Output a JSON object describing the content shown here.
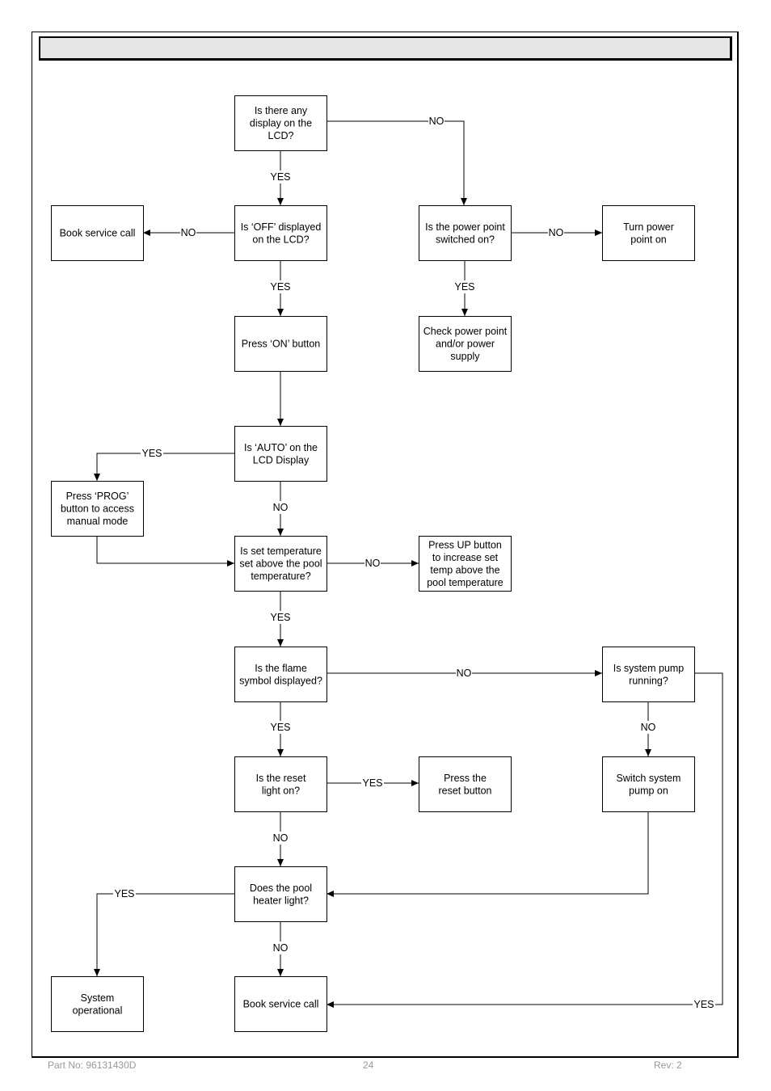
{
  "title_bar": {
    "text": ""
  },
  "nodes": [
    {
      "id": "n_display",
      "lines": [
        "Is there any",
        "display on the",
        "LCD?"
      ]
    },
    {
      "id": "n_off",
      "lines": [
        "Is ‘OFF’ displayed",
        "on the LCD?"
      ]
    },
    {
      "id": "n_book1",
      "lines": [
        "Book service call"
      ]
    },
    {
      "id": "n_power",
      "lines": [
        "Is the power point",
        "switched on?"
      ]
    },
    {
      "id": "n_turnon",
      "lines": [
        "Turn power",
        "point on"
      ]
    },
    {
      "id": "n_check",
      "lines": [
        "Check power point",
        "and/or power",
        "supply"
      ]
    },
    {
      "id": "n_presson",
      "lines": [
        "Press ‘ON’ button"
      ]
    },
    {
      "id": "n_auto",
      "lines": [
        "Is ‘AUTO’ on the",
        "LCD Display"
      ]
    },
    {
      "id": "n_prog",
      "lines": [
        "Press ‘PROG’",
        "button to access",
        "manual mode"
      ]
    },
    {
      "id": "n_settemp",
      "lines": [
        "Is set temperature",
        "set above the pool",
        "temperature?"
      ]
    },
    {
      "id": "n_pressup",
      "lines": [
        "Press UP button",
        "to increase set",
        "temp above the",
        "pool temperature"
      ]
    },
    {
      "id": "n_flame",
      "lines": [
        "Is the flame",
        "symbol displayed?"
      ]
    },
    {
      "id": "n_pump",
      "lines": [
        "Is system pump",
        "running?"
      ]
    },
    {
      "id": "n_reset",
      "lines": [
        "Is the reset",
        "light on?"
      ]
    },
    {
      "id": "n_pressreset",
      "lines": [
        "Press the",
        "reset button"
      ]
    },
    {
      "id": "n_switchpump",
      "lines": [
        "Switch system",
        "pump on"
      ]
    },
    {
      "id": "n_heater",
      "lines": [
        "Does the pool",
        "heater light?"
      ]
    },
    {
      "id": "n_operational",
      "lines": [
        "System",
        "operational"
      ]
    },
    {
      "id": "n_book2",
      "lines": [
        "Book service call"
      ]
    }
  ],
  "edges": [
    {
      "from": "n_display",
      "to": "n_off",
      "label": "YES"
    },
    {
      "from": "n_display",
      "to": "n_power",
      "label": "NO"
    },
    {
      "from": "n_off",
      "to": "n_book1",
      "label": "NO"
    },
    {
      "from": "n_off",
      "to": "n_presson",
      "label": "YES"
    },
    {
      "from": "n_power",
      "to": "n_turnon",
      "label": "NO"
    },
    {
      "from": "n_power",
      "to": "n_check",
      "label": "YES"
    },
    {
      "from": "n_presson",
      "to": "n_auto",
      "label": ""
    },
    {
      "from": "n_auto",
      "to": "n_prog",
      "label": "YES"
    },
    {
      "from": "n_auto",
      "to": "n_settemp",
      "label": "NO"
    },
    {
      "from": "n_prog",
      "to": "n_settemp",
      "label": ""
    },
    {
      "from": "n_settemp",
      "to": "n_pressup",
      "label": "NO"
    },
    {
      "from": "n_settemp",
      "to": "n_flame",
      "label": "YES"
    },
    {
      "from": "n_flame",
      "to": "n_pump",
      "label": "NO"
    },
    {
      "from": "n_flame",
      "to": "n_reset",
      "label": "YES"
    },
    {
      "from": "n_reset",
      "to": "n_pressreset",
      "label": "YES"
    },
    {
      "from": "n_reset",
      "to": "n_heater",
      "label": "NO"
    },
    {
      "from": "n_pump",
      "to": "n_switchpump",
      "label": "NO"
    },
    {
      "from": "n_pump",
      "to": "n_book2",
      "label": "YES"
    },
    {
      "from": "n_switchpump",
      "to": "n_heater",
      "label": ""
    },
    {
      "from": "n_heater",
      "to": "n_operational",
      "label": "YES"
    },
    {
      "from": "n_heater",
      "to": "n_book2",
      "label": "NO"
    }
  ],
  "footer": {
    "part_no": "Part No:   96131430D",
    "page": "24",
    "rev": "Rev: 2"
  }
}
